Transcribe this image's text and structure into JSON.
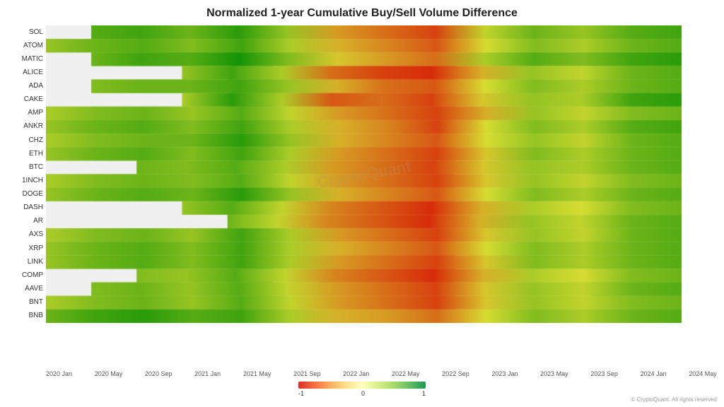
{
  "title": "Normalized 1-year Cumulative Buy/Sell Volume Difference",
  "yLabels": [
    "SOL",
    "ATOM",
    "MATIC",
    "ALICE",
    "ADA",
    "CAKE",
    "AMP",
    "ANKR",
    "CHZ",
    "ETH",
    "BTC",
    "1INCH",
    "DOGE",
    "DASH",
    "AR",
    "AXS",
    "XRP",
    "LINK",
    "COMP",
    "AAVE",
    "BNT",
    "BNB"
  ],
  "xLabels": [
    "2020 Jan",
    "2020 May",
    "2020 Sep",
    "2021 Jan",
    "2021 May",
    "2021 Sep",
    "2022 Jan",
    "2022 May",
    "2022 Sep",
    "2023 Jan",
    "2023 May",
    "2023 Sep",
    "2024 Jan",
    "2024 May"
  ],
  "legend": {
    "min": "-1",
    "mid": "0",
    "max": "1"
  },
  "watermark": "CryptoQuant",
  "copyright": "© CryptoQuant. All rights reserved"
}
